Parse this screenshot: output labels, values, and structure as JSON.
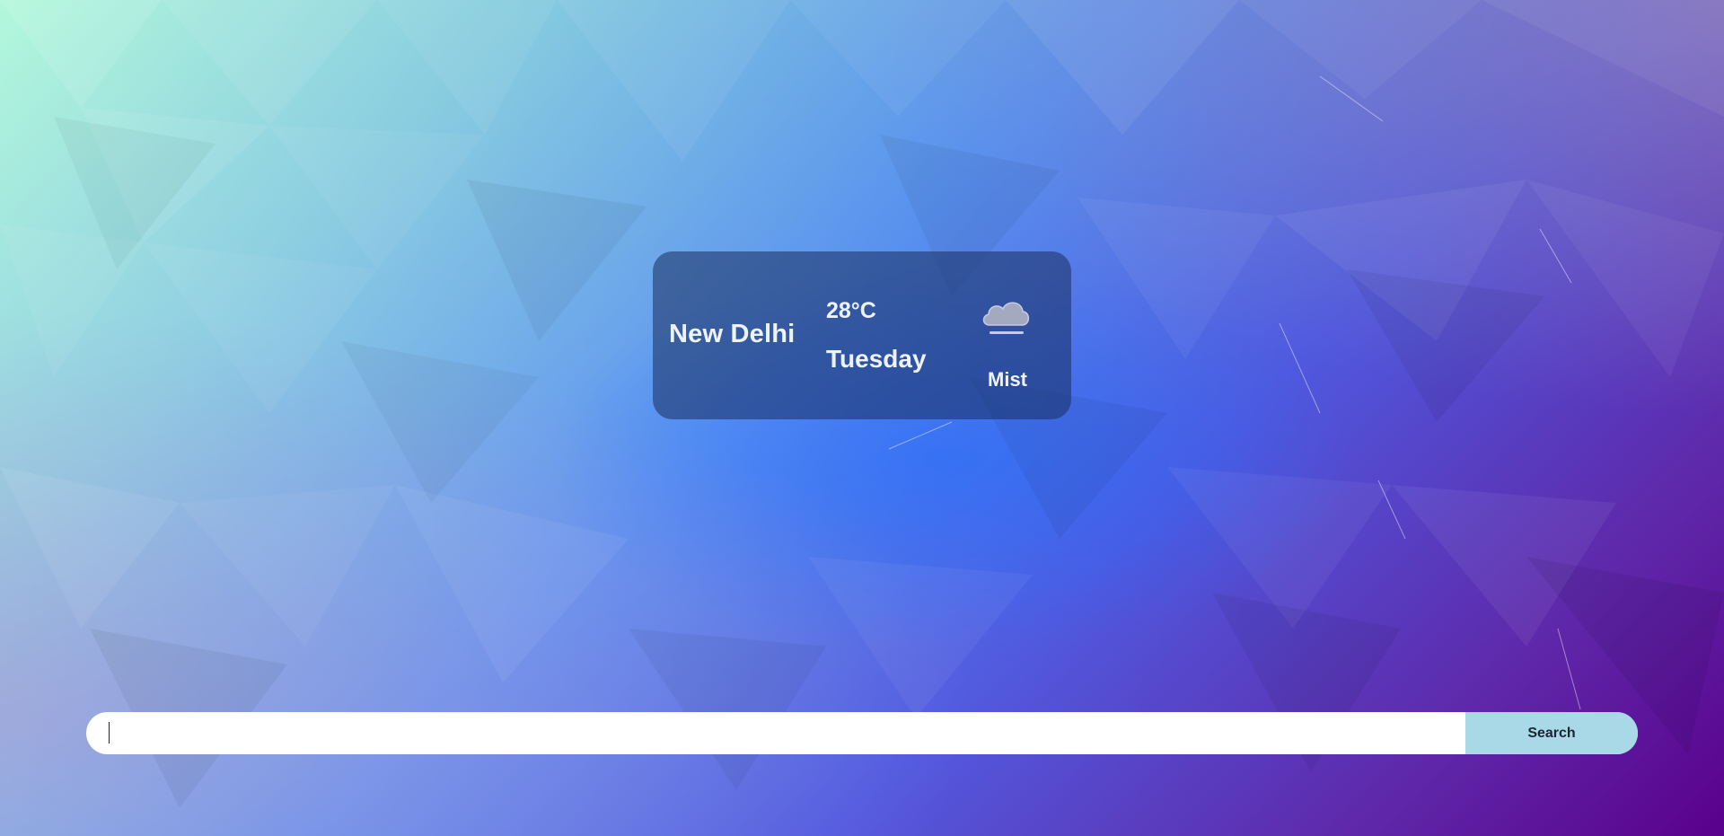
{
  "weather": {
    "city": "New Delhi",
    "temperature": "28°C",
    "day": "Tuesday",
    "condition": "Mist",
    "icon": "mist-cloud-icon"
  },
  "search": {
    "value": "",
    "placeholder": "",
    "button_label": "Search"
  },
  "colors": {
    "card_background": "#2a3f78",
    "button_background": "#a9d8e6",
    "search_background": "#ffffff"
  }
}
